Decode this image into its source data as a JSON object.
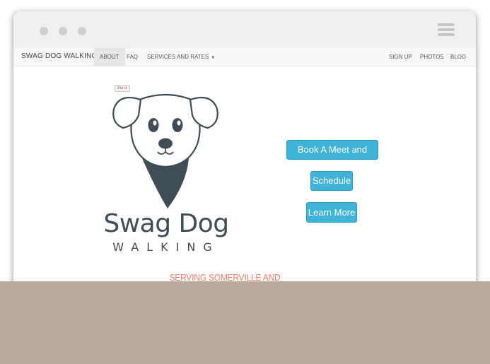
{
  "window": {
    "traffic_lights": [
      "close",
      "minimize",
      "maximize"
    ],
    "menu_icon": "hamburger-menu-icon"
  },
  "navbar": {
    "brand": "SWAG DOG WALKING",
    "left_items": [
      "ABOUT",
      "FAQ",
      "SERVICES AND RATES"
    ],
    "active_item": "ABOUT",
    "right_items": [
      "SIGN UP",
      "PHOTOS",
      "BLOG"
    ]
  },
  "hero": {
    "pin_badge": "Pin it",
    "logo_name": "Swag Dog",
    "logo_sub": "WALKING",
    "tagline": "SERVING SOMERVILLE AND CAMBRIDGE"
  },
  "buttons": {
    "meet_greet": "Book A Meet and Greet",
    "schedule": "Schedule",
    "learn_more": "Learn More"
  },
  "colors": {
    "accent": "#3fb4d8",
    "tagline": "#ef7a62",
    "logo": "#3e4d56",
    "footer": "#bba99c"
  }
}
